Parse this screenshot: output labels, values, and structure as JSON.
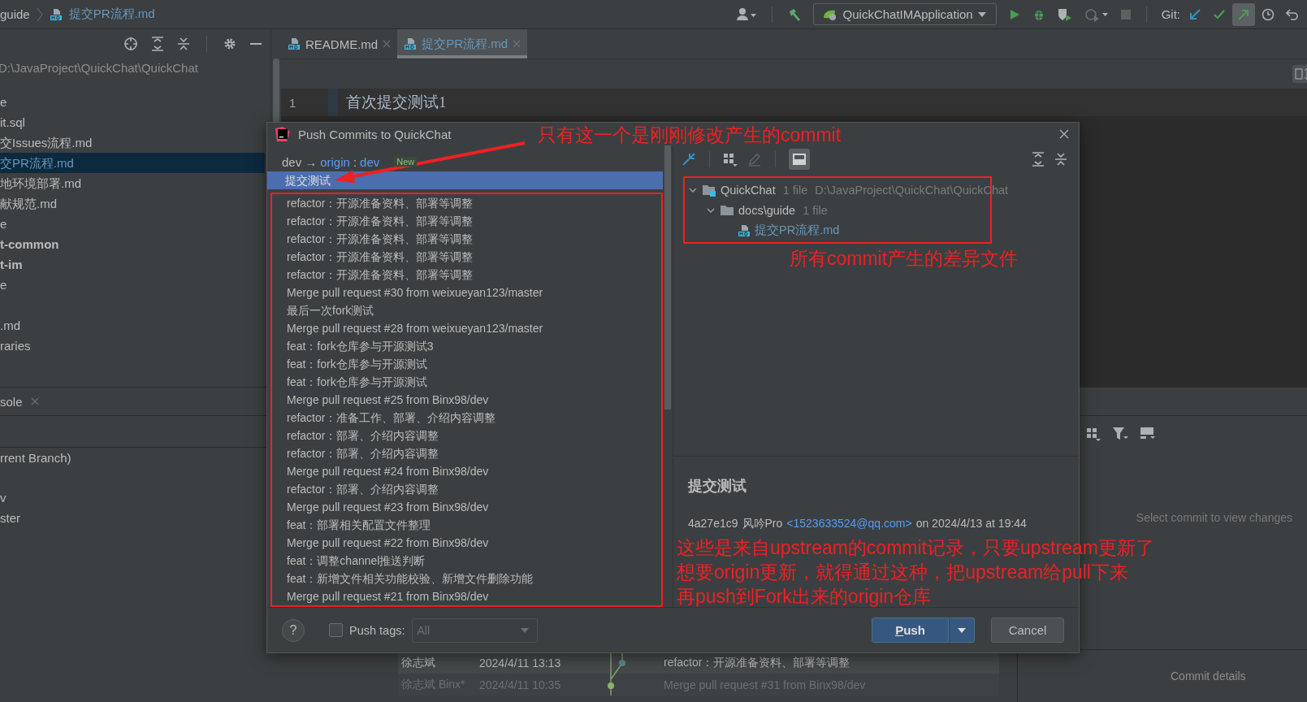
{
  "breadcrumb": [
    {
      "label": "guide",
      "kind": "folder"
    },
    {
      "label": "提交PR流程.md",
      "kind": "file"
    }
  ],
  "toolbar": {
    "run_config": "QuickChatIMApplication",
    "git_label": "Git:"
  },
  "project_tree": {
    "path": "D:\\JavaProject\\QuickChat\\QuickChat",
    "items": [
      {
        "label": "e",
        "selected": false,
        "bold": false
      },
      {
        "label": "it.sql",
        "selected": false,
        "bold": false
      },
      {
        "label": "交Issues流程.md",
        "selected": false,
        "bold": false
      },
      {
        "label": "交PR流程.md",
        "selected": true,
        "bold": false
      },
      {
        "label": "地环境部署.md",
        "selected": false,
        "bold": false
      },
      {
        "label": "献规范.md",
        "selected": false,
        "bold": false
      },
      {
        "label": "e",
        "selected": false,
        "bold": false
      },
      {
        "label": "t-common",
        "selected": false,
        "bold": true
      },
      {
        "label": "t-im",
        "selected": false,
        "bold": true
      },
      {
        "label": "e",
        "selected": false,
        "bold": false
      },
      {
        "label": ".md",
        "selected": false,
        "bold": false
      },
      {
        "label": "raries",
        "selected": false,
        "bold": false
      }
    ]
  },
  "editor_tabs": [
    {
      "label": "README.md",
      "selected": false
    },
    {
      "label": "提交PR流程.md",
      "selected": true
    }
  ],
  "editor": {
    "lines": [
      {
        "number": "1",
        "text": "首次提交测试1"
      }
    ]
  },
  "tool_tabs": [
    {
      "label": "sole"
    }
  ],
  "branches": [
    {
      "label": "rrent Branch)"
    },
    {
      "label": "v"
    },
    {
      "label": "ster"
    }
  ],
  "log": {
    "rows": [
      {
        "author": "徐志斌",
        "date": "2024/4/11 13:13",
        "message": "refactor：开源准备资料、部署等调整",
        "dimmed": false
      },
      {
        "author": "徐志斌 Binx*",
        "date": "2024/4/11 10:35",
        "message": "Merge pull request #31 from Binx98/dev",
        "dimmed": true
      }
    ]
  },
  "details": {
    "hint": "Select commit to view changes",
    "title": "Commit details"
  },
  "dialog": {
    "title": "Push Commits to QuickChat",
    "branch": {
      "local": "dev",
      "arrow": "→",
      "remote": "origin",
      "separator": ":",
      "remote_branch": "dev",
      "badge": "New"
    },
    "commits": [
      {
        "message": "提交测试",
        "selected": true
      },
      {
        "message": "refactor：开源准备资料、部署等调整",
        "selected": false
      },
      {
        "message": "refactor：开源准备资料、部署等调整",
        "selected": false
      },
      {
        "message": "refactor：开源准备资料、部署等调整",
        "selected": false
      },
      {
        "message": "refactor：开源准备资料、部署等调整",
        "selected": false
      },
      {
        "message": "refactor：开源准备资料、部署等调整",
        "selected": false
      },
      {
        "message": "Merge pull request #30 from weixueyan123/master",
        "selected": false
      },
      {
        "message": "最后一次fork测试",
        "selected": false
      },
      {
        "message": "Merge pull request #28 from weixueyan123/master",
        "selected": false
      },
      {
        "message": "feat：fork仓库参与开源测试3",
        "selected": false
      },
      {
        "message": "feat：fork仓库参与开源测试",
        "selected": false
      },
      {
        "message": "feat：fork仓库参与开源测试",
        "selected": false
      },
      {
        "message": "Merge pull request #25 from Binx98/dev",
        "selected": false
      },
      {
        "message": "refactor：准备工作、部署、介绍内容调整",
        "selected": false
      },
      {
        "message": "refactor：部署、介绍内容调整",
        "selected": false
      },
      {
        "message": "refactor：部署、介绍内容调整",
        "selected": false
      },
      {
        "message": "Merge pull request #24 from Binx98/dev",
        "selected": false
      },
      {
        "message": "refactor：部署、介绍内容调整",
        "selected": false
      },
      {
        "message": "Merge pull request #23 from Binx98/dev",
        "selected": false
      },
      {
        "message": "feat：部署相关配置文件整理",
        "selected": false
      },
      {
        "message": "Merge pull request #22 from Binx98/dev",
        "selected": false
      },
      {
        "message": "feat：调整channel推送判断",
        "selected": false
      },
      {
        "message": "feat：新增文件相关功能校验、新增文件删除功能",
        "selected": false
      },
      {
        "message": "Merge pull request #21 from Binx98/dev",
        "selected": false
      }
    ],
    "changes": [
      {
        "kind": "module",
        "label": "QuickChat",
        "count": "1 file",
        "path": "D:\\JavaProject\\QuickChat\\QuickChat",
        "expanded": true,
        "children": [
          {
            "kind": "folder",
            "label": "docs\\guide",
            "count": "1 file",
            "expanded": true,
            "children": [
              {
                "kind": "file",
                "label": "提交PR流程.md"
              }
            ]
          }
        ]
      }
    ],
    "commit_detail": {
      "title": "提交测试",
      "hash": "4a27e1c9",
      "author": "风吟Pro",
      "email": "<1523633524@qq.com>",
      "date": "on 2024/4/13 at 19:44"
    },
    "footer": {
      "help": "?",
      "push_tags": {
        "label": "Push tags:",
        "checked": false
      },
      "tags_select": {
        "value": "All",
        "disabled": true
      },
      "push": "Push",
      "cancel": "Cancel"
    }
  },
  "annotations": {
    "pointer_note": "只有这一个是刚刚修改产生的commit",
    "files_note": "所有commit产生的差异文件",
    "upstream_note": [
      "这些是来自upstream的commit记录，只要upstream更新了",
      "想要origin更新，就得通过这种，把upstream给pull下来",
      "再push到Fork出来的origin仓库"
    ]
  }
}
